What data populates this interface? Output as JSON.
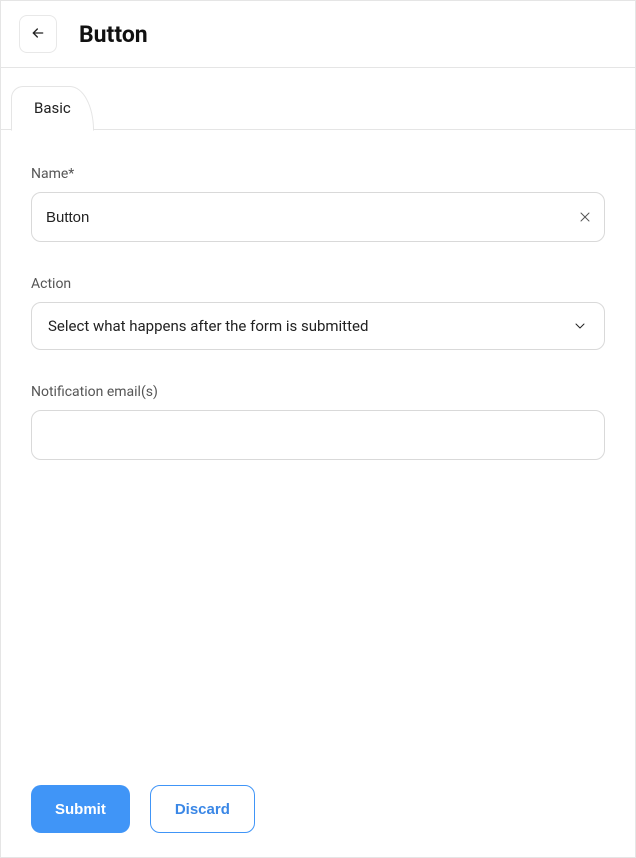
{
  "header": {
    "title": "Button"
  },
  "tabs": [
    {
      "label": "Basic"
    }
  ],
  "form": {
    "name": {
      "label": "Name*",
      "value": "Button"
    },
    "action": {
      "label": "Action",
      "placeholder": "Select what happens after the form is submitted"
    },
    "emails": {
      "label": "Notification email(s)",
      "value": ""
    }
  },
  "footer": {
    "submit_label": "Submit",
    "discard_label": "Discard"
  }
}
